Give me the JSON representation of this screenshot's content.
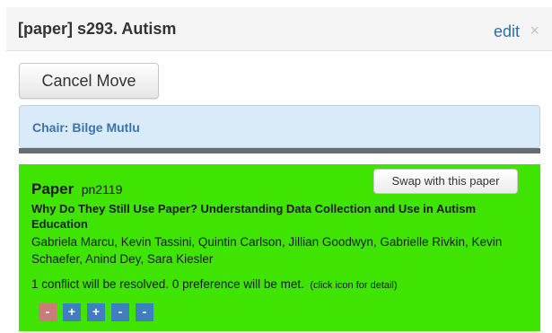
{
  "header": {
    "title": "[paper] s293. Autism",
    "edit_label": "edit",
    "close_glyph": "×"
  },
  "actions": {
    "cancel_move_label": "Cancel Move"
  },
  "chair": {
    "label": "Chair: Bilge Mutlu"
  },
  "paper": {
    "heading_word": "Paper",
    "id": "pn2119",
    "swap_label": "Swap with this paper",
    "title": "Why Do They Still Use Paper? Understanding Data Collection and Use in Autism Education",
    "authors": "Gabriela Marcu, Kevin Tassini, Quintin Carlson, Jillian Goodwyn, Gabrielle Rivkin, Kevin Schaefer, Anind Dey, Sara Kiesler",
    "conflict_text": "1 conflict will be resolved. 0 preference will be met.",
    "conflict_note": "(click icon for detail)",
    "background_color": "#3fe400",
    "preference_icons": [
      {
        "glyph": "-",
        "color": "#c87d7a",
        "icon": "minus-icon"
      },
      {
        "glyph": "+",
        "color": "#3f7fc0",
        "icon": "plus-icon"
      },
      {
        "glyph": "+",
        "color": "#3f7fc0",
        "icon": "plus-icon"
      },
      {
        "glyph": "-",
        "color": "#3f7fc0",
        "icon": "minus-icon"
      },
      {
        "glyph": "-",
        "color": "#3f7fc0",
        "icon": "minus-icon"
      }
    ]
  }
}
